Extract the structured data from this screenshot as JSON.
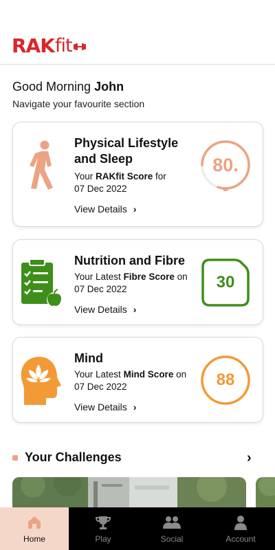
{
  "app": {
    "logo_left": "RAK",
    "logo_right": "fit"
  },
  "greeting": {
    "prefix": "Good Morning ",
    "name": "John",
    "subtitle": "Navigate your favourite section"
  },
  "cards": [
    {
      "title_line1": "Physical Lifestyle",
      "title_line2": "and Sleep",
      "desc_prefix": "Your ",
      "desc_bold": "RAKfit Score",
      "desc_suffix": " for",
      "date": "07 Dec 2022",
      "link": "View Details",
      "score": "80.",
      "color": "#eba383",
      "icon": "walking-person-icon"
    },
    {
      "title_line1": "Nutrition and Fibre",
      "desc_prefix": "Your Latest ",
      "desc_bold": "Fibre Score",
      "desc_suffix": " on",
      "date": "07 Dec 2022",
      "link": "View Details",
      "score": "30",
      "color": "#3e8e1a",
      "icon": "clipboard-apple-icon"
    },
    {
      "title_line1": "Mind",
      "desc_prefix": "Your Latest ",
      "desc_bold": "Mind Score",
      "desc_suffix": " on",
      "date": "07 Dec 2022",
      "link": "View Details",
      "score": "88",
      "color": "#f29a36",
      "icon": "head-lotus-icon"
    }
  ],
  "challenges": {
    "title": "Your Challenges"
  },
  "nav": [
    {
      "label": "Home",
      "icon": "home-icon",
      "active": true
    },
    {
      "label": "Play",
      "icon": "trophy-icon",
      "active": false
    },
    {
      "label": "Social",
      "icon": "people-icon",
      "active": false
    },
    {
      "label": "Account",
      "icon": "user-icon",
      "active": false
    }
  ],
  "colors": {
    "brand": "#d9262b",
    "physical": "#eba383",
    "nutrition": "#3e8e1a",
    "mind": "#f29a36",
    "nav_bg": "#000000",
    "nav_active": "#f5d7c9"
  }
}
